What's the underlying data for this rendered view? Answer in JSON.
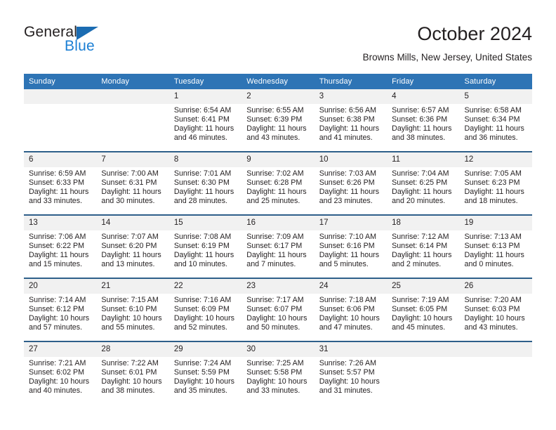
{
  "brand": {
    "name_part1": "General",
    "name_part2": "Blue",
    "triangle_color": "#1b6cb2",
    "blue_color": "#1b7fd4"
  },
  "header": {
    "title": "October 2024",
    "subtitle": "Browns Mills, New Jersey, United States"
  },
  "theme": {
    "header_bg": "#2e74b5",
    "row_divider": "#2e5f8a",
    "daynum_bg": "#f1f1f1",
    "text": "#231f20"
  },
  "weekday_headers": [
    "Sunday",
    "Monday",
    "Tuesday",
    "Wednesday",
    "Thursday",
    "Friday",
    "Saturday"
  ],
  "labels": {
    "sunrise_prefix": "Sunrise:",
    "sunset_prefix": "Sunset:",
    "daylight_prefix": "Daylight:"
  },
  "weeks": [
    [
      {
        "day": "",
        "blank": true
      },
      {
        "day": "",
        "blank": true
      },
      {
        "day": "1",
        "sunrise": "Sunrise: 6:54 AM",
        "sunset": "Sunset: 6:41 PM",
        "daylight_line1": "Daylight: 11 hours",
        "daylight_line2": "and 46 minutes."
      },
      {
        "day": "2",
        "sunrise": "Sunrise: 6:55 AM",
        "sunset": "Sunset: 6:39 PM",
        "daylight_line1": "Daylight: 11 hours",
        "daylight_line2": "and 43 minutes."
      },
      {
        "day": "3",
        "sunrise": "Sunrise: 6:56 AM",
        "sunset": "Sunset: 6:38 PM",
        "daylight_line1": "Daylight: 11 hours",
        "daylight_line2": "and 41 minutes."
      },
      {
        "day": "4",
        "sunrise": "Sunrise: 6:57 AM",
        "sunset": "Sunset: 6:36 PM",
        "daylight_line1": "Daylight: 11 hours",
        "daylight_line2": "and 38 minutes."
      },
      {
        "day": "5",
        "sunrise": "Sunrise: 6:58 AM",
        "sunset": "Sunset: 6:34 PM",
        "daylight_line1": "Daylight: 11 hours",
        "daylight_line2": "and 36 minutes."
      }
    ],
    [
      {
        "day": "6",
        "sunrise": "Sunrise: 6:59 AM",
        "sunset": "Sunset: 6:33 PM",
        "daylight_line1": "Daylight: 11 hours",
        "daylight_line2": "and 33 minutes."
      },
      {
        "day": "7",
        "sunrise": "Sunrise: 7:00 AM",
        "sunset": "Sunset: 6:31 PM",
        "daylight_line1": "Daylight: 11 hours",
        "daylight_line2": "and 30 minutes."
      },
      {
        "day": "8",
        "sunrise": "Sunrise: 7:01 AM",
        "sunset": "Sunset: 6:30 PM",
        "daylight_line1": "Daylight: 11 hours",
        "daylight_line2": "and 28 minutes."
      },
      {
        "day": "9",
        "sunrise": "Sunrise: 7:02 AM",
        "sunset": "Sunset: 6:28 PM",
        "daylight_line1": "Daylight: 11 hours",
        "daylight_line2": "and 25 minutes."
      },
      {
        "day": "10",
        "sunrise": "Sunrise: 7:03 AM",
        "sunset": "Sunset: 6:26 PM",
        "daylight_line1": "Daylight: 11 hours",
        "daylight_line2": "and 23 minutes."
      },
      {
        "day": "11",
        "sunrise": "Sunrise: 7:04 AM",
        "sunset": "Sunset: 6:25 PM",
        "daylight_line1": "Daylight: 11 hours",
        "daylight_line2": "and 20 minutes."
      },
      {
        "day": "12",
        "sunrise": "Sunrise: 7:05 AM",
        "sunset": "Sunset: 6:23 PM",
        "daylight_line1": "Daylight: 11 hours",
        "daylight_line2": "and 18 minutes."
      }
    ],
    [
      {
        "day": "13",
        "sunrise": "Sunrise: 7:06 AM",
        "sunset": "Sunset: 6:22 PM",
        "daylight_line1": "Daylight: 11 hours",
        "daylight_line2": "and 15 minutes."
      },
      {
        "day": "14",
        "sunrise": "Sunrise: 7:07 AM",
        "sunset": "Sunset: 6:20 PM",
        "daylight_line1": "Daylight: 11 hours",
        "daylight_line2": "and 13 minutes."
      },
      {
        "day": "15",
        "sunrise": "Sunrise: 7:08 AM",
        "sunset": "Sunset: 6:19 PM",
        "daylight_line1": "Daylight: 11 hours",
        "daylight_line2": "and 10 minutes."
      },
      {
        "day": "16",
        "sunrise": "Sunrise: 7:09 AM",
        "sunset": "Sunset: 6:17 PM",
        "daylight_line1": "Daylight: 11 hours",
        "daylight_line2": "and 7 minutes."
      },
      {
        "day": "17",
        "sunrise": "Sunrise: 7:10 AM",
        "sunset": "Sunset: 6:16 PM",
        "daylight_line1": "Daylight: 11 hours",
        "daylight_line2": "and 5 minutes."
      },
      {
        "day": "18",
        "sunrise": "Sunrise: 7:12 AM",
        "sunset": "Sunset: 6:14 PM",
        "daylight_line1": "Daylight: 11 hours",
        "daylight_line2": "and 2 minutes."
      },
      {
        "day": "19",
        "sunrise": "Sunrise: 7:13 AM",
        "sunset": "Sunset: 6:13 PM",
        "daylight_line1": "Daylight: 11 hours",
        "daylight_line2": "and 0 minutes."
      }
    ],
    [
      {
        "day": "20",
        "sunrise": "Sunrise: 7:14 AM",
        "sunset": "Sunset: 6:12 PM",
        "daylight_line1": "Daylight: 10 hours",
        "daylight_line2": "and 57 minutes."
      },
      {
        "day": "21",
        "sunrise": "Sunrise: 7:15 AM",
        "sunset": "Sunset: 6:10 PM",
        "daylight_line1": "Daylight: 10 hours",
        "daylight_line2": "and 55 minutes."
      },
      {
        "day": "22",
        "sunrise": "Sunrise: 7:16 AM",
        "sunset": "Sunset: 6:09 PM",
        "daylight_line1": "Daylight: 10 hours",
        "daylight_line2": "and 52 minutes."
      },
      {
        "day": "23",
        "sunrise": "Sunrise: 7:17 AM",
        "sunset": "Sunset: 6:07 PM",
        "daylight_line1": "Daylight: 10 hours",
        "daylight_line2": "and 50 minutes."
      },
      {
        "day": "24",
        "sunrise": "Sunrise: 7:18 AM",
        "sunset": "Sunset: 6:06 PM",
        "daylight_line1": "Daylight: 10 hours",
        "daylight_line2": "and 47 minutes."
      },
      {
        "day": "25",
        "sunrise": "Sunrise: 7:19 AM",
        "sunset": "Sunset: 6:05 PM",
        "daylight_line1": "Daylight: 10 hours",
        "daylight_line2": "and 45 minutes."
      },
      {
        "day": "26",
        "sunrise": "Sunrise: 7:20 AM",
        "sunset": "Sunset: 6:03 PM",
        "daylight_line1": "Daylight: 10 hours",
        "daylight_line2": "and 43 minutes."
      }
    ],
    [
      {
        "day": "27",
        "sunrise": "Sunrise: 7:21 AM",
        "sunset": "Sunset: 6:02 PM",
        "daylight_line1": "Daylight: 10 hours",
        "daylight_line2": "and 40 minutes."
      },
      {
        "day": "28",
        "sunrise": "Sunrise: 7:22 AM",
        "sunset": "Sunset: 6:01 PM",
        "daylight_line1": "Daylight: 10 hours",
        "daylight_line2": "and 38 minutes."
      },
      {
        "day": "29",
        "sunrise": "Sunrise: 7:24 AM",
        "sunset": "Sunset: 5:59 PM",
        "daylight_line1": "Daylight: 10 hours",
        "daylight_line2": "and 35 minutes."
      },
      {
        "day": "30",
        "sunrise": "Sunrise: 7:25 AM",
        "sunset": "Sunset: 5:58 PM",
        "daylight_line1": "Daylight: 10 hours",
        "daylight_line2": "and 33 minutes."
      },
      {
        "day": "31",
        "sunrise": "Sunrise: 7:26 AM",
        "sunset": "Sunset: 5:57 PM",
        "daylight_line1": "Daylight: 10 hours",
        "daylight_line2": "and 31 minutes."
      },
      {
        "day": "",
        "blank": true
      },
      {
        "day": "",
        "blank": true
      }
    ]
  ]
}
